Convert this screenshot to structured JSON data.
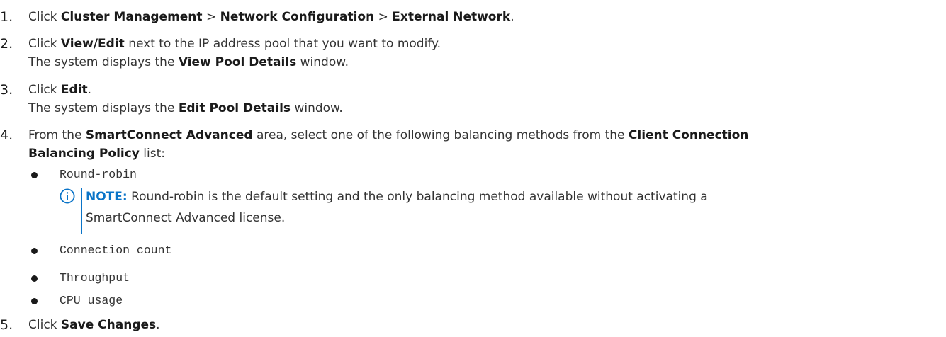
{
  "steps": [
    {
      "number": "1.",
      "parts": [
        "Click ",
        "Cluster Management",
        " > ",
        "Network Configuration",
        " > ",
        "External Network",
        "."
      ]
    },
    {
      "number": "2.",
      "line1": [
        "Click ",
        "View/Edit",
        " next to the IP address pool that you want to modify."
      ],
      "line2": [
        "The system displays the ",
        "View Pool Details",
        " window."
      ]
    },
    {
      "number": "3.",
      "line1": [
        "Click ",
        "Edit",
        "."
      ],
      "line2": [
        "The system displays the ",
        "Edit Pool Details",
        " window."
      ]
    },
    {
      "number": "4.",
      "line1": [
        "From the ",
        "SmartConnect Advanced",
        " area, select one of the following balancing methods from the ",
        "Client Connection"
      ],
      "line2": [
        "Balancing Policy",
        " list:"
      ],
      "options": [
        "Round-robin",
        "Connection count",
        "Throughput",
        "CPU usage"
      ],
      "note": {
        "label": "NOTE:",
        "line1": " Round-robin is the default setting and the only balancing method available without activating a",
        "line2": "SmartConnect Advanced license."
      }
    },
    {
      "number": "5.",
      "parts": [
        "Click ",
        "Save Changes",
        "."
      ]
    }
  ],
  "colors": {
    "note_accent": "#0a74c8",
    "text": "#333333"
  },
  "icons": {
    "note": "info-circle-icon"
  }
}
